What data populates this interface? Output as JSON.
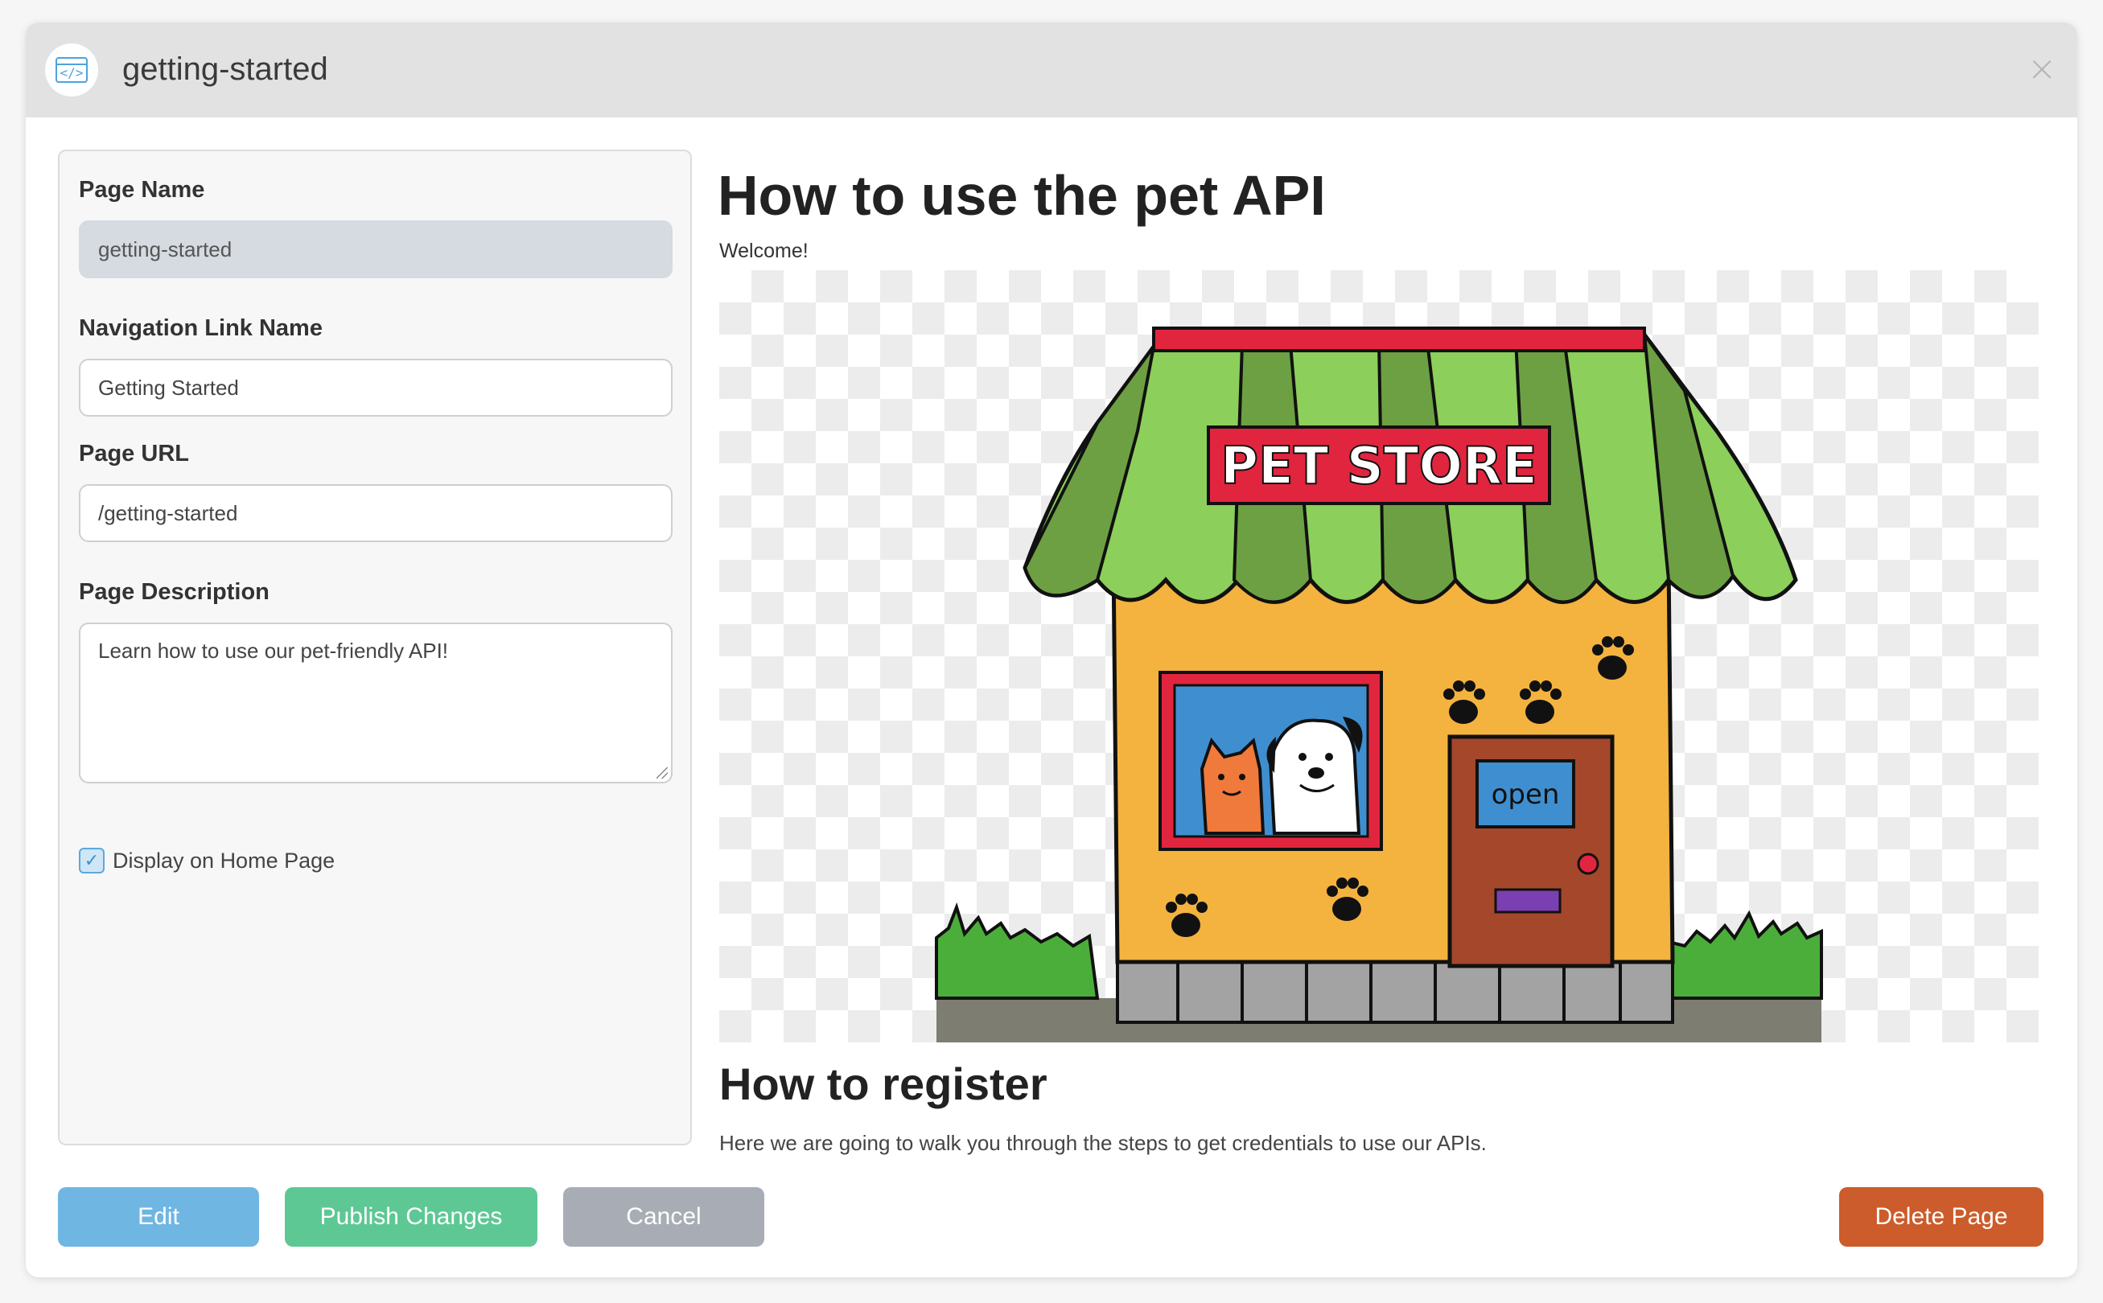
{
  "header": {
    "title": "getting-started",
    "app_icon": "code-window-icon",
    "close_icon": "close-icon"
  },
  "form": {
    "page_name": {
      "label": "Page Name",
      "value": "getting-started"
    },
    "nav_link_name": {
      "label": "Navigation Link Name",
      "value": "Getting Started"
    },
    "page_url": {
      "label": "Page URL",
      "value": "/getting-started"
    },
    "page_description": {
      "label": "Page Description",
      "value": "Learn how to use our pet-friendly API!"
    },
    "display_on_home": {
      "label": "Display on Home Page",
      "checked": true
    }
  },
  "preview": {
    "heading": "How to use the pet API",
    "welcome": "Welcome!",
    "image": {
      "sign_text": "PET STORE",
      "door_sign_text": "open"
    },
    "subheading": "How to register",
    "paragraph": "Here we are going to walk you through the steps to get credentials to use our APIs."
  },
  "buttons": {
    "edit": "Edit",
    "publish": "Publish Changes",
    "cancel": "Cancel",
    "delete": "Delete Page"
  },
  "colors": {
    "edit": "#6fb6e3",
    "publish": "#5ec895",
    "cancel": "#a8adb5",
    "delete": "#cc5c2b",
    "header_bg": "#e2e2e2"
  }
}
